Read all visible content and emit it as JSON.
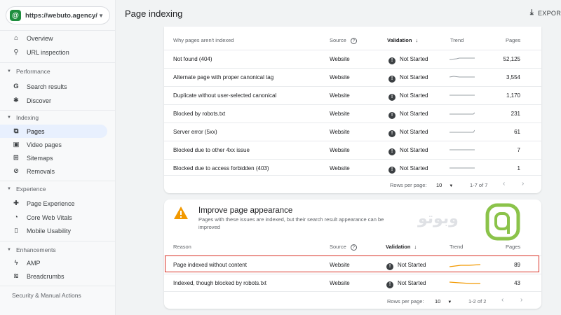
{
  "property": {
    "url": "https://webuto.agency/",
    "logo_letter": "@"
  },
  "sidebar": {
    "overview": "Overview",
    "url_inspection": "URL inspection",
    "performance": {
      "title": "Performance",
      "items": [
        "Search results",
        "Discover"
      ]
    },
    "indexing": {
      "title": "Indexing",
      "items": [
        "Pages",
        "Video pages",
        "Sitemaps",
        "Removals"
      ]
    },
    "experience": {
      "title": "Experience",
      "items": [
        "Page Experience",
        "Core Web Vitals",
        "Mobile Usability"
      ]
    },
    "enhancements": {
      "title": "Enhancements",
      "items": [
        "AMP",
        "Breadcrumbs"
      ]
    },
    "security": {
      "title": "Security & Manual Actions"
    }
  },
  "header": {
    "title": "Page indexing",
    "export": "EXPOR"
  },
  "table1": {
    "headers": {
      "reason": "Why pages aren't indexed",
      "source": "Source",
      "validation": "Validation",
      "trend": "Trend",
      "pages": "Pages"
    },
    "rows": [
      {
        "reason": "Not found (404)",
        "source": "Website",
        "validation": "Not Started",
        "pages": "52,125"
      },
      {
        "reason": "Alternate page with proper canonical tag",
        "source": "Website",
        "validation": "Not Started",
        "pages": "3,554"
      },
      {
        "reason": "Duplicate without user-selected canonical",
        "source": "Website",
        "validation": "Not Started",
        "pages": "1,170"
      },
      {
        "reason": "Blocked by robots.txt",
        "source": "Website",
        "validation": "Not Started",
        "pages": "231"
      },
      {
        "reason": "Server error (5xx)",
        "source": "Website",
        "validation": "Not Started",
        "pages": "61"
      },
      {
        "reason": "Blocked due to other 4xx issue",
        "source": "Website",
        "validation": "Not Started",
        "pages": "7"
      },
      {
        "reason": "Blocked due to access forbidden (403)",
        "source": "Website",
        "validation": "Not Started",
        "pages": "1"
      }
    ],
    "footer": {
      "rows_label": "Rows per page:",
      "rows_value": "10",
      "range": "1-7 of 7"
    }
  },
  "card2": {
    "title": "Improve page appearance",
    "description": "Pages with these issues are indexed, but their search result appearance can be improved",
    "headers": {
      "reason": "Reason",
      "source": "Source",
      "validation": "Validation",
      "trend": "Trend",
      "pages": "Pages"
    },
    "rows": [
      {
        "reason": "Page indexed without content",
        "source": "Website",
        "validation": "Not Started",
        "pages": "89"
      },
      {
        "reason": "Indexed, though blocked by robots.txt",
        "source": "Website",
        "validation": "Not Started",
        "pages": "43"
      }
    ],
    "footer": {
      "rows_label": "Rows per page:",
      "rows_value": "10",
      "range": "1-2 of 2"
    }
  },
  "watermark_text": "وبوتو",
  "colors": {
    "accent": "#1a73e8",
    "highlight": "#d93025",
    "trend_orange": "#f29900",
    "logo_green": "#8bc34a"
  }
}
